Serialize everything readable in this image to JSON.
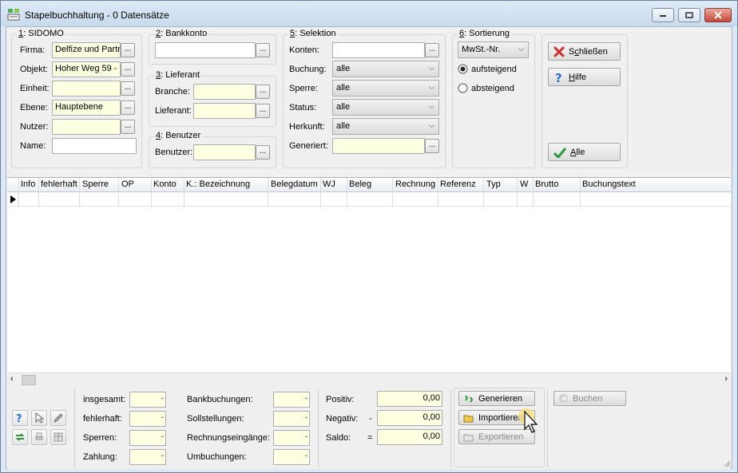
{
  "window": {
    "title": "Stapelbuchhaltung - 0 Datensätze"
  },
  "sidomo": {
    "title_num": "1",
    "title_rest": ": SIDOMO",
    "firma_label": "Firma:",
    "firma_value": "Delfize und Partr",
    "objekt_label": "Objekt:",
    "objekt_value": "Hoher Weg 59 -",
    "einheit_label": "Einheit:",
    "einheit_value": "",
    "ebene_label": "Ebene:",
    "ebene_value": "Hauptebene",
    "nutzer_label": "Nutzer:",
    "nutzer_value": "",
    "name_label": "Name:",
    "name_value": ""
  },
  "bankkonto": {
    "title_num": "2",
    "title_rest": ": Bankkonto",
    "value": ""
  },
  "lieferant": {
    "title_num": "3",
    "title_rest": ": Lieferant",
    "branche_label": "Branche:",
    "branche_value": "",
    "lieferant_label": "Lieferant:",
    "lieferant_value": ""
  },
  "benutzer": {
    "title_num": "4",
    "title_rest": ": Benutzer",
    "benutzer_label": "Benutzer:",
    "benutzer_value": ""
  },
  "selektion": {
    "title_num": "5",
    "title_rest": ": Selektion",
    "konten_label": "Konten:",
    "konten_value": "",
    "buchung_label": "Buchung:",
    "buchung_value": "alle",
    "sperre_label": "Sperre:",
    "sperre_value": "alle",
    "status_label": "Status:",
    "status_value": "alle",
    "herkunft_label": "Herkunft:",
    "herkunft_value": "alle",
    "generiert_label": "Generiert:",
    "generiert_value": ""
  },
  "sortierung": {
    "title_num": "6",
    "title_rest": ": Sortierung",
    "field_value": "MwSt.-Nr.",
    "asc_label": "aufsteigend",
    "desc_label": "absteigend",
    "selected": "aufsteigend"
  },
  "actions": {
    "close_pre": "S",
    "close_u": "c",
    "close_post": "hließen",
    "help_u": "H",
    "help_post": "ilfe",
    "all_u": "A",
    "all_post": "lle"
  },
  "table": {
    "columns": [
      "Info",
      "fehlerhaft",
      "Sperre",
      "OP",
      "Konto",
      "K.: Bezeichnung",
      "Belegdatum",
      "WJ",
      "Beleg",
      "Rechnung",
      "Referenz",
      "Typ",
      "W",
      "Brutto",
      "Buchungstext"
    ],
    "rows": []
  },
  "stats": {
    "insgesamt_label": "insgesamt:",
    "insgesamt_value": "-",
    "fehlerhaft_label": "fehlerhaft:",
    "fehlerhaft_value": "-",
    "sperren_label": "Sperren:",
    "sperren_value": "-",
    "zahlung_label": "Zahlung:",
    "zahlung_value": "-",
    "bank_label": "Bankbuchungen:",
    "bank_value": "-",
    "soll_label": "Sollstellungen:",
    "soll_value": "-",
    "rechnung_label": "Rechnungseingänge:",
    "rechnung_value": "-",
    "umbuch_label": "Umbuchungen:",
    "umbuch_value": "-"
  },
  "totals": {
    "positiv_label": "Positiv:",
    "positiv_sign": "",
    "positiv_value": "0,00",
    "negativ_label": "Negativ:",
    "negativ_sign": "-",
    "negativ_value": "0,00",
    "saldo_label": "Saldo:",
    "saldo_sign": "=",
    "saldo_value": "0,00"
  },
  "bottom_actions": {
    "generieren": "Generieren",
    "importieren": "Importieren",
    "exportieren": "Exportieren",
    "buchen": "Buchen"
  }
}
